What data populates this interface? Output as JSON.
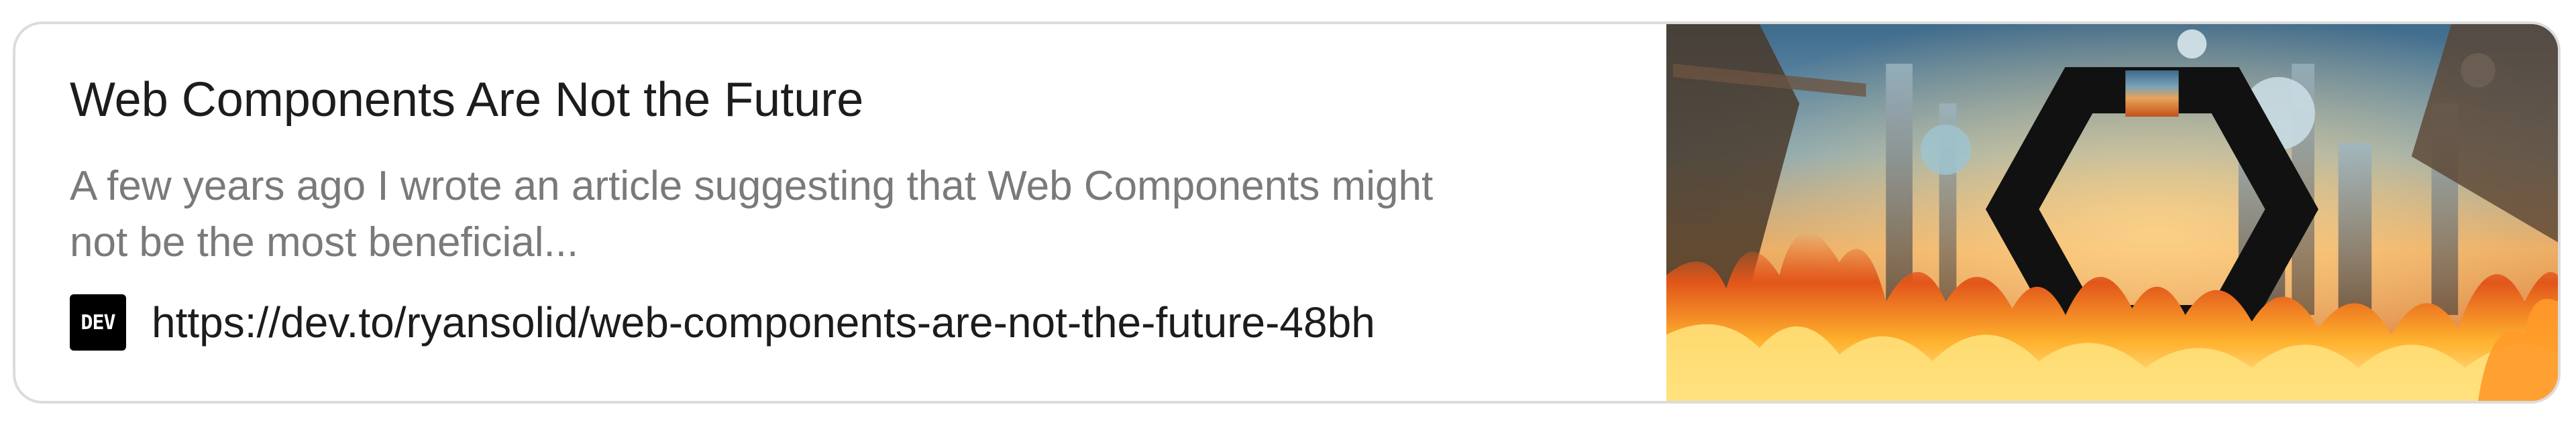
{
  "card": {
    "title": "Web Components Are Not the Future",
    "description_line1": "A few years ago I wrote an article suggesting that Web Components might",
    "description_line2": "not be the most beneficial...",
    "favicon_text": "DEV",
    "url": "https://dev.to/ryansolid/web-components-are-not-the-future-48bh",
    "thumbnail_icon": "hexagon-logo-icon"
  },
  "colors": {
    "border": "#dcdcdc",
    "title": "#1c1c1e",
    "description": "#7a7a7a",
    "favicon_bg": "#000000"
  }
}
